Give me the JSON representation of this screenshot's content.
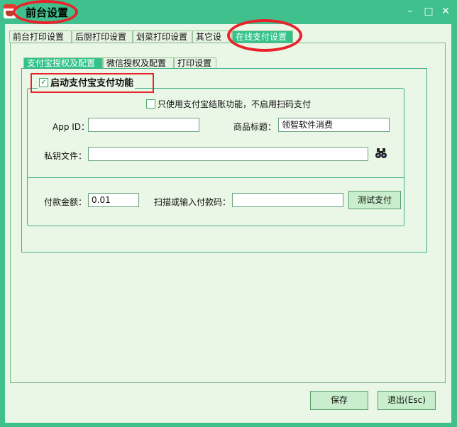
{
  "window": {
    "title": "前台设置",
    "controls": {
      "minimize": "–",
      "maximize": "□",
      "close": "✕"
    }
  },
  "tabs": [
    "前台打印设置",
    "后厨打印设置",
    "划菜打印设置",
    "其它设置",
    "在线支付设置"
  ],
  "subtabs": [
    "支付宝授权及配置",
    "微信授权及配置",
    "打印设置"
  ],
  "alipay": {
    "enable_label": "启动支付宝支付功能",
    "enable_checked": true,
    "settle_only_label": "只使用支付宝结账功能，不启用扫码支付",
    "settle_only_checked": false,
    "app_id_label": "App ID：",
    "app_id_value": "",
    "product_title_label": "商品标题：",
    "product_title_value": "领智软件消费",
    "private_key_label": "私钥文件：",
    "private_key_value": "",
    "amount_label": "付款金额：",
    "amount_value": "0.01",
    "pay_code_label": "扫描或输入付款码：",
    "pay_code_value": "",
    "test_button": "测试支付"
  },
  "footer": {
    "save": "保存",
    "exit": "退出(Esc)"
  },
  "colors": {
    "window": "#3fc08c",
    "panel": "#eaf6e6",
    "highlight": "#e8232b"
  },
  "icons": {
    "browse": "binoculars-icon",
    "app": "app-logo-icon"
  }
}
